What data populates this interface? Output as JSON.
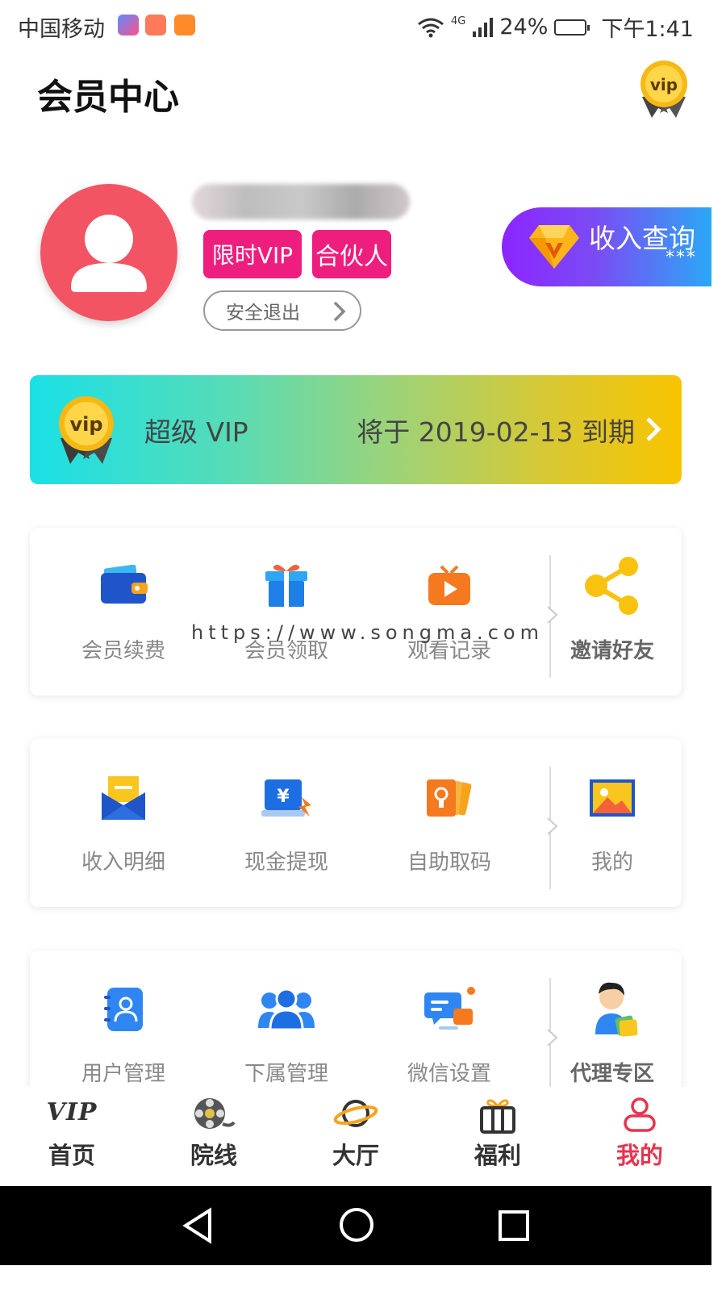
{
  "status_bar": {
    "carrier": "中国移动",
    "network": "4G",
    "battery": "24%",
    "time": "下午1:41"
  },
  "header": {
    "title": "会员中心",
    "vip_badge_text": "vip"
  },
  "profile": {
    "tags": [
      "限时VIP",
      "合伙人"
    ],
    "logout_label": "安全退出",
    "income_label": "收入查询",
    "income_value": "***"
  },
  "vip_banner": {
    "medal_text": "vip",
    "level": "超级 VIP",
    "expire": "将于 2019-02-13 到期"
  },
  "watermark": "https://www.songma.com",
  "cards": [
    {
      "items": [
        "会员续费",
        "会员领取",
        "观看记录",
        "邀请好友"
      ]
    },
    {
      "items": [
        "收入明细",
        "现金提现",
        "自助取码",
        "我的"
      ]
    },
    {
      "items": [
        "用户管理",
        "下属管理",
        "微信设置",
        "代理专区"
      ]
    }
  ],
  "tabbar": {
    "tabs": [
      "首页",
      "院线",
      "大厅",
      "福利",
      "我的"
    ],
    "vip_logo": "VIP",
    "active_index": 4
  },
  "colors": {
    "accent": "#e8344f",
    "tag_pink": "#ee1e7e",
    "avatar": "#f25463"
  }
}
